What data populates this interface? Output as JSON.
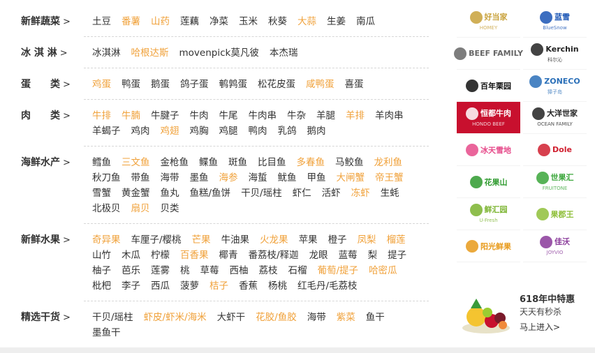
{
  "categories": [
    {
      "title": "新鲜蔬菜",
      "items": [
        {
          "t": "土豆"
        },
        {
          "t": "番薯",
          "hl": true
        },
        {
          "t": "山药",
          "hl": true
        },
        {
          "t": "莲藕"
        },
        {
          "t": "净菜"
        },
        {
          "t": "玉米"
        },
        {
          "t": "秋葵"
        },
        {
          "t": "大蒜",
          "hl": true
        },
        {
          "t": "生姜"
        },
        {
          "t": "南瓜"
        }
      ]
    },
    {
      "title": "冰 淇 淋",
      "items": [
        {
          "t": "冰淇淋"
        },
        {
          "t": "哈根达斯",
          "hl": true
        },
        {
          "t": "movenpick莫凡彼"
        },
        {
          "t": "本杰瑞"
        }
      ]
    },
    {
      "title": "蛋　　类",
      "items": [
        {
          "t": "鸡蛋",
          "hl": true
        },
        {
          "t": "鸭蛋"
        },
        {
          "t": "鹅蛋"
        },
        {
          "t": "鸽子蛋"
        },
        {
          "t": "鹌鹑蛋"
        },
        {
          "t": "松花皮蛋"
        },
        {
          "t": "咸鸭蛋",
          "hl": true
        },
        {
          "t": "喜蛋"
        }
      ]
    },
    {
      "title": "肉　　类",
      "items": [
        {
          "t": "牛排",
          "hl": true
        },
        {
          "t": "牛腩",
          "hl": true
        },
        {
          "t": "牛腱子"
        },
        {
          "t": "牛肉"
        },
        {
          "t": "牛尾"
        },
        {
          "t": "牛肉串"
        },
        {
          "t": "牛杂"
        },
        {
          "t": "羊腿"
        },
        {
          "t": "羊排",
          "hl": true
        },
        {
          "t": "羊肉串"
        },
        {
          "t": "羊蝎子"
        },
        {
          "t": "鸡肉"
        },
        {
          "t": "鸡翅",
          "hl": true
        },
        {
          "t": "鸡胸"
        },
        {
          "t": "鸡腿"
        },
        {
          "t": "鸭肉"
        },
        {
          "t": "乳鸽"
        },
        {
          "t": "鹅肉"
        }
      ]
    },
    {
      "title": "海鲜水产",
      "items": [
        {
          "t": "鳕鱼"
        },
        {
          "t": "三文鱼",
          "hl": true
        },
        {
          "t": "金枪鱼"
        },
        {
          "t": "鲽鱼"
        },
        {
          "t": "斑鱼"
        },
        {
          "t": "比目鱼"
        },
        {
          "t": "多春鱼",
          "hl": true
        },
        {
          "t": "马鲛鱼"
        },
        {
          "t": "龙利鱼",
          "hl": true
        },
        {
          "t": "秋刀鱼"
        },
        {
          "t": "带鱼"
        },
        {
          "t": "海带"
        },
        {
          "t": "墨鱼"
        },
        {
          "t": "海参",
          "hl": true
        },
        {
          "t": "海蜇"
        },
        {
          "t": "鱿鱼"
        },
        {
          "t": "甲鱼"
        },
        {
          "t": "大闸蟹",
          "hl": true
        },
        {
          "t": "帝王蟹",
          "hl": true
        },
        {
          "t": "雪蟹"
        },
        {
          "t": "黄金蟹"
        },
        {
          "t": "鱼丸"
        },
        {
          "t": "鱼糕/鱼饼"
        },
        {
          "t": "干贝/瑶柱"
        },
        {
          "t": "虾仁"
        },
        {
          "t": "活虾"
        },
        {
          "t": "冻虾",
          "hl": true
        },
        {
          "t": "生蚝"
        },
        {
          "t": "北极贝"
        },
        {
          "t": "扇贝",
          "hl": true
        },
        {
          "t": "贝类"
        }
      ]
    },
    {
      "title": "新鲜水果",
      "items": [
        {
          "t": "奇异果",
          "hl": true
        },
        {
          "t": "车厘子/樱桃"
        },
        {
          "t": "芒果",
          "hl": true
        },
        {
          "t": "牛油果"
        },
        {
          "t": "火龙果",
          "hl": true
        },
        {
          "t": "苹果"
        },
        {
          "t": "橙子"
        },
        {
          "t": "凤梨",
          "hl": true
        },
        {
          "t": "榴莲",
          "hl": true
        },
        {
          "t": "山竹"
        },
        {
          "t": "木瓜"
        },
        {
          "t": "柠檬"
        },
        {
          "t": "百香果",
          "hl": true
        },
        {
          "t": "椰青"
        },
        {
          "t": "番荔枝/释迦"
        },
        {
          "t": "龙眼"
        },
        {
          "t": "蓝莓"
        },
        {
          "t": "梨"
        },
        {
          "t": "提子"
        },
        {
          "t": "柚子"
        },
        {
          "t": "芭乐"
        },
        {
          "t": "莲雾"
        },
        {
          "t": "桃"
        },
        {
          "t": "草莓"
        },
        {
          "t": "西柚"
        },
        {
          "t": "荔枝"
        },
        {
          "t": "石榴"
        },
        {
          "t": "葡萄/提子",
          "hl": true
        },
        {
          "t": "哈密瓜",
          "hl": true
        },
        {
          "t": "枇杷"
        },
        {
          "t": "李子"
        },
        {
          "t": "西瓜"
        },
        {
          "t": "菠萝"
        },
        {
          "t": "桔子",
          "hl": true
        },
        {
          "t": "香蕉"
        },
        {
          "t": "杨桃"
        },
        {
          "t": "红毛丹/毛荔枝"
        }
      ]
    },
    {
      "title": "精选干货",
      "items": [
        {
          "t": "干贝/瑶柱"
        },
        {
          "t": "虾皮/虾米/海米",
          "hl": true
        },
        {
          "t": "大虾干"
        },
        {
          "t": "花胶/鱼胶",
          "hl": true
        },
        {
          "t": "海带"
        },
        {
          "t": "紫菜",
          "hl": true
        },
        {
          "t": "鱼干"
        },
        {
          "t": "墨鱼干"
        }
      ]
    }
  ],
  "arrow": ">",
  "brands": [
    {
      "name": "好当家",
      "sub": "HOMEY",
      "color": "#c8a13a",
      "icon": "homey-badge-icon"
    },
    {
      "name": "蓝雪",
      "sub": "BlueSnow",
      "color": "#1a55b5",
      "icon": "bluesnow-icon"
    },
    {
      "name": "BEEF FAMILY",
      "sub": "",
      "color": "#666666",
      "icon": "beef-family-icon"
    },
    {
      "name": "Kerchin",
      "sub": "科尔沁",
      "color": "#222222",
      "icon": "kerchin-icon"
    },
    {
      "name": "百年栗园",
      "sub": "",
      "color": "#111111",
      "icon": "chestnut-icon"
    },
    {
      "name": "ZONECO",
      "sub": "獐子岛",
      "color": "#2a6fb8",
      "icon": "zoneco-icon"
    },
    {
      "name": "恒都牛肉",
      "sub": "HONDO BEEF",
      "color": "#ffffff",
      "bg": "#c8102e",
      "icon": "hondo-icon"
    },
    {
      "name": "大洋世家",
      "sub": "OCEAN FAMILY",
      "color": "#222222",
      "icon": "ocean-family-icon"
    },
    {
      "name": "冰天雪地",
      "sub": "",
      "color": "#e64a8a",
      "icon": "ice-circle-icon"
    },
    {
      "name": "Dole",
      "sub": "",
      "color": "#d01f2f",
      "icon": "dole-icon"
    },
    {
      "name": "花果山",
      "sub": "",
      "color": "#2e9a2e",
      "icon": "flower-fruit-icon"
    },
    {
      "name": "世果汇",
      "sub": "FRUITONE",
      "color": "#3aa63a",
      "icon": "fruitone-icon"
    },
    {
      "name": "鲜汇园",
      "sub": "U-Fresh",
      "color": "#7ab32e",
      "icon": "ufresh-icon"
    },
    {
      "name": "果郡王",
      "sub": "",
      "color": "#8fbf3a",
      "icon": "guojunwang-icon"
    },
    {
      "name": "阳光鲜果",
      "sub": "",
      "color": "#e89a1a",
      "icon": "sunshine-icon"
    },
    {
      "name": "佳沃",
      "sub": "JOYVIO",
      "color": "#8a3a9a",
      "icon": "joyvio-icon"
    }
  ],
  "promo": {
    "title": "618年中特惠",
    "subtitle": "天天有秒杀",
    "link": "马上进入>"
  }
}
